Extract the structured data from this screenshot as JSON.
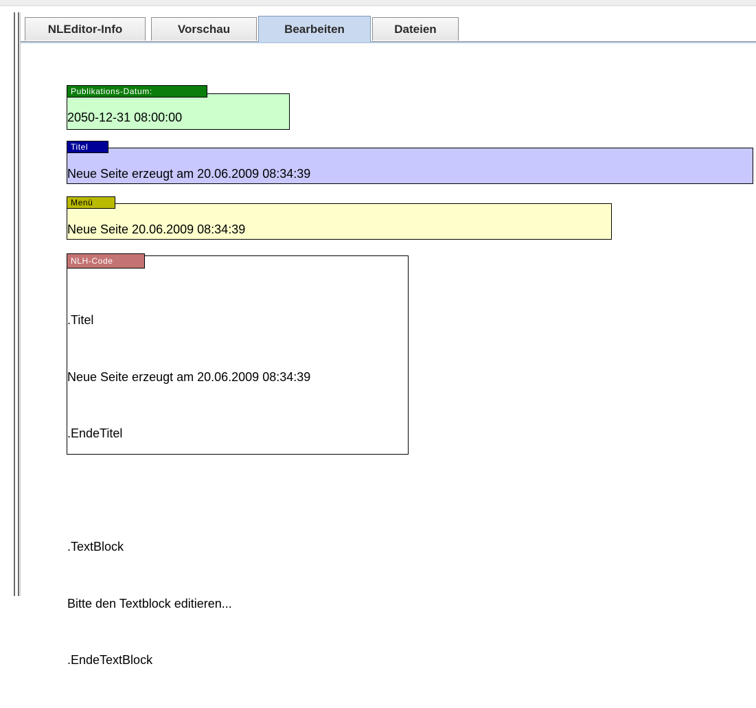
{
  "tabs": [
    {
      "label": "NLEditor-Info",
      "selected": false
    },
    {
      "label": "Vorschau",
      "selected": false
    },
    {
      "label": "Bearbeiten",
      "selected": true
    },
    {
      "label": "Dateien",
      "selected": false
    }
  ],
  "fields": {
    "publish_date": {
      "label": "Publikations-Datum:",
      "value": "2050-12-31 08:00:00",
      "label_bg": "#0b7d0b",
      "label_color": "#ffffff",
      "box_bg": "#ccffcc"
    },
    "title": {
      "label": "Titel",
      "value": "Neue Seite erzeugt am 20.06.2009 08:34:39",
      "label_bg": "#000099",
      "label_color": "#ffffff",
      "box_bg": "#c8c8ff"
    },
    "menu": {
      "label": "Menü",
      "value": "Neue Seite 20.06.2009 08:34:39",
      "label_bg": "#b9b900",
      "label_color": "#000000",
      "box_bg": "#ffffcc"
    },
    "nlh_code": {
      "label": "NLH-Code",
      "label_bg": "#c47373",
      "label_color": "#ffffff",
      "box_bg": "#ffffff",
      "lines": [
        ".Titel",
        "Neue Seite erzeugt am 20.06.2009 08:34:39",
        ".EndeTitel",
        "",
        ".TextBlock",
        "Bitte den Textblock editieren...",
        ".EndeTextBlock"
      ]
    }
  }
}
